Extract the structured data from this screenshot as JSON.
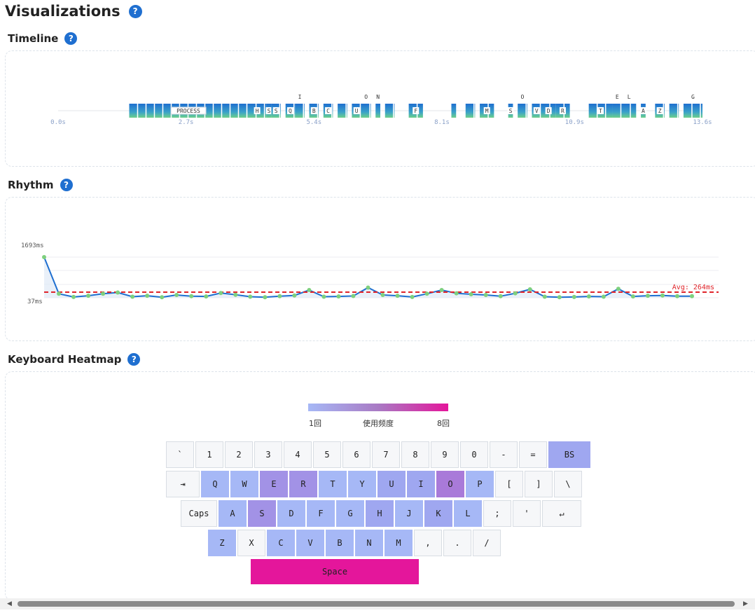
{
  "page": {
    "title": "Visualizations",
    "help_glyph": "?"
  },
  "sections": {
    "timeline": {
      "title": "Timeline"
    },
    "rhythm": {
      "title": "Rhythm"
    },
    "heatmap": {
      "title": "Keyboard Heatmap"
    }
  },
  "timeline": {
    "ticks": [
      "0.0s",
      "2.7s",
      "5.4s",
      "8.1s",
      "10.9s",
      "13.6s"
    ],
    "tick_values": [
      0,
      2.7,
      5.4,
      8.1,
      10.9,
      13.6
    ],
    "max_seconds": 13.6,
    "events": [
      {
        "label": "PROCESS",
        "start": 1.5,
        "end": 4.0
      },
      {
        "label": "H",
        "start": 4.0,
        "end": 4.4
      },
      {
        "label": "S",
        "start": 4.4,
        "end": 4.5
      },
      {
        "label": "S",
        "start": 4.5,
        "end": 4.7
      },
      {
        "label": "Q",
        "start": 4.8,
        "end": 5.0
      },
      {
        "label": "I",
        "start": 5.0,
        "end": 5.2
      },
      {
        "label": "B",
        "start": 5.3,
        "end": 5.5
      },
      {
        "label": "C",
        "start": 5.6,
        "end": 5.8
      },
      {
        "label": "",
        "start": 5.9,
        "end": 6.1
      },
      {
        "label": "U",
        "start": 6.2,
        "end": 6.4
      },
      {
        "label": "O",
        "start": 6.4,
        "end": 6.6
      },
      {
        "label": "N",
        "start": 6.7,
        "end": 6.8
      },
      {
        "label": "",
        "start": 6.9,
        "end": 7.1
      },
      {
        "label": "F",
        "start": 7.4,
        "end": 7.7
      },
      {
        "label": "",
        "start": 8.3,
        "end": 8.4
      },
      {
        "label": "",
        "start": 8.6,
        "end": 8.8
      },
      {
        "label": "M",
        "start": 8.9,
        "end": 9.2
      },
      {
        "label": "S",
        "start": 9.5,
        "end": 9.6
      },
      {
        "label": "O",
        "start": 9.7,
        "end": 9.9
      },
      {
        "label": "V",
        "start": 10.0,
        "end": 10.2
      },
      {
        "label": "D",
        "start": 10.2,
        "end": 10.5
      },
      {
        "label": "R",
        "start": 10.5,
        "end": 10.8
      },
      {
        "label": "T",
        "start": 11.2,
        "end": 11.7
      },
      {
        "label": "E",
        "start": 11.7,
        "end": 11.9
      },
      {
        "label": "L",
        "start": 11.9,
        "end": 12.2
      },
      {
        "label": "A",
        "start": 12.3,
        "end": 12.4
      },
      {
        "label": "Z",
        "start": 12.6,
        "end": 12.8
      },
      {
        "label": "",
        "start": 12.9,
        "end": 13.1
      },
      {
        "label": "G",
        "start": 13.2,
        "end": 13.6
      }
    ]
  },
  "chart_data": {
    "type": "line",
    "title": "",
    "ymax_label": "1693ms",
    "ymin_label": "37ms",
    "ymax": 1693,
    "ymin": 37,
    "avg_label": "Avg: 264ms",
    "avg": 264,
    "colors": {
      "line": "#1f6fd0",
      "point": "#7ed07e",
      "avg": "#e0242a"
    },
    "values": [
      1693,
      200,
      70,
      120,
      200,
      250,
      80,
      120,
      60,
      150,
      100,
      90,
      230,
      160,
      80,
      60,
      100,
      130,
      350,
      80,
      90,
      110,
      450,
      150,
      120,
      70,
      200,
      350,
      220,
      180,
      150,
      100,
      220,
      380,
      80,
      60,
      70,
      90,
      80,
      400,
      90,
      120,
      130,
      100,
      100
    ]
  },
  "heatmap": {
    "legend": {
      "min": "1回",
      "mid": "使用频度",
      "max": "8回"
    },
    "keys": [
      [
        {
          "label": "`",
          "count": 0
        },
        {
          "label": "1",
          "count": 0
        },
        {
          "label": "2",
          "count": 0
        },
        {
          "label": "3",
          "count": 0
        },
        {
          "label": "4",
          "count": 0
        },
        {
          "label": "5",
          "count": 0
        },
        {
          "label": "6",
          "count": 0
        },
        {
          "label": "7",
          "count": 0
        },
        {
          "label": "8",
          "count": 0
        },
        {
          "label": "9",
          "count": 0
        },
        {
          "label": "0",
          "count": 0
        },
        {
          "label": "-",
          "count": 0
        },
        {
          "label": "=",
          "count": 0
        },
        {
          "label": "BS",
          "count": 2
        }
      ],
      [
        {
          "label": "⇥",
          "count": 0
        },
        {
          "label": "Q",
          "count": 1
        },
        {
          "label": "W",
          "count": 1
        },
        {
          "label": "E",
          "count": 3
        },
        {
          "label": "R",
          "count": 3
        },
        {
          "label": "T",
          "count": 1
        },
        {
          "label": "Y",
          "count": 1
        },
        {
          "label": "U",
          "count": 2
        },
        {
          "label": "I",
          "count": 2
        },
        {
          "label": "O",
          "count": 4
        },
        {
          "label": "P",
          "count": 1
        },
        {
          "label": "[",
          "count": 0
        },
        {
          "label": "]",
          "count": 0
        },
        {
          "label": "\\",
          "count": 0
        }
      ],
      [
        {
          "label": "Caps",
          "count": 0
        },
        {
          "label": "A",
          "count": 1
        },
        {
          "label": "S",
          "count": 3
        },
        {
          "label": "D",
          "count": 1
        },
        {
          "label": "F",
          "count": 1
        },
        {
          "label": "G",
          "count": 1
        },
        {
          "label": "H",
          "count": 2
        },
        {
          "label": "J",
          "count": 1
        },
        {
          "label": "K",
          "count": 2
        },
        {
          "label": "L",
          "count": 1
        },
        {
          "label": ";",
          "count": 0
        },
        {
          "label": "'",
          "count": 0
        },
        {
          "label": "↵",
          "count": 0
        }
      ],
      [
        {
          "label": "Z",
          "count": 1
        },
        {
          "label": "X",
          "count": 0
        },
        {
          "label": "C",
          "count": 1
        },
        {
          "label": "V",
          "count": 1
        },
        {
          "label": "B",
          "count": 1
        },
        {
          "label": "N",
          "count": 1
        },
        {
          "label": "M",
          "count": 1
        },
        {
          "label": ",",
          "count": 0
        },
        {
          "label": ".",
          "count": 0
        },
        {
          "label": "/",
          "count": 0
        }
      ],
      [
        {
          "label": "Space",
          "count": 8
        }
      ]
    ]
  }
}
